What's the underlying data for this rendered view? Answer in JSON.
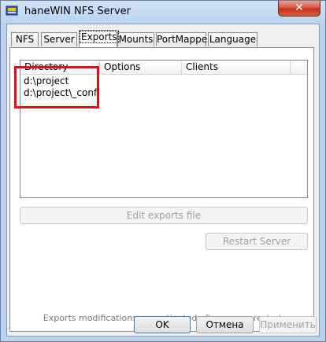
{
  "window": {
    "title": "haneWIN NFS Server",
    "close_symbol": "✕"
  },
  "tabs": [
    {
      "label": "NFS"
    },
    {
      "label": "Server"
    },
    {
      "label": "Exports",
      "active": true
    },
    {
      "label": "Mounts"
    },
    {
      "label": "PortMapper"
    },
    {
      "label": "Language"
    }
  ],
  "exports_list": {
    "columns": [
      "Directory",
      "Options",
      "Clients"
    ],
    "rows": [
      {
        "directory": "d:\\project",
        "options": "",
        "clients": ""
      },
      {
        "directory": "d:\\project\\_conf",
        "options": "",
        "clients": ""
      }
    ]
  },
  "buttons": {
    "edit_exports": "Edit exports file",
    "restart_server": "Restart Server",
    "ok": "OK",
    "cancel": "Отмена",
    "apply": "Применить"
  },
  "info_text": "Exports modifications are activated after server restart",
  "colors": {
    "highlight": "#e01010",
    "title_bg": "#b9d3ee",
    "close_red": "#c6321c"
  }
}
